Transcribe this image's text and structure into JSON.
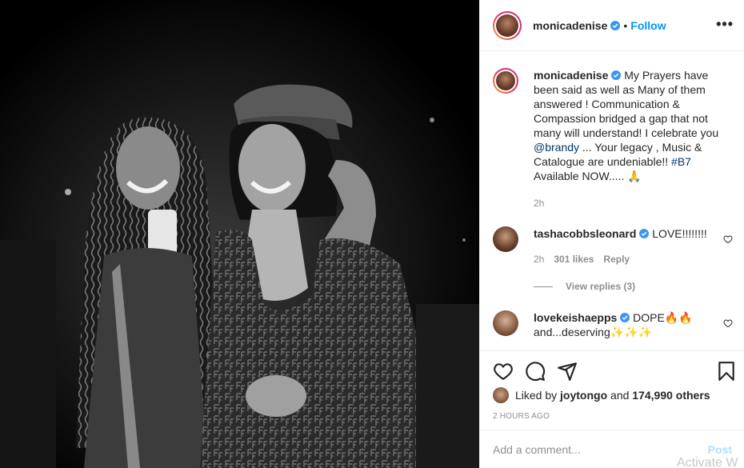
{
  "post": {
    "username": "monicadenise",
    "follow_label": "Follow",
    "separator": "•",
    "more_label": "•••"
  },
  "caption": {
    "username": "monicadenise",
    "text_part1": "My Prayers have been said as well as Many of them answered ! Communication & Compassion bridged a gap that not many will understand! I celebrate you ",
    "mention": "@brandy",
    "text_part2": " ... Your legacy , Music & Catalogue are undeniable!! ",
    "hashtag": "#B7",
    "text_part3": " Available NOW..... 🙏",
    "time": "2h"
  },
  "comments": [
    {
      "username": "tashacobbsleonard",
      "text": "LOVE!!!!!!!!",
      "time": "2h",
      "likes": "301 likes",
      "reply_label": "Reply",
      "view_replies": "View replies (3)"
    },
    {
      "username": "lovekeishaepps",
      "text": "DOPE🔥🔥 and...deserving✨✨✨",
      "time": ""
    }
  ],
  "likes": {
    "prefix": "Liked by",
    "user": "joytongo",
    "and": "and",
    "count": "174,990 others"
  },
  "timestamp": "2 HOURS AGO",
  "add_comment": {
    "placeholder": "Add a comment...",
    "post_label": "Post"
  },
  "watermark": "Activate W",
  "colors": {
    "accent": "#0095f6",
    "verified": "#3897f0",
    "post_disabled": "#b2dffc"
  }
}
